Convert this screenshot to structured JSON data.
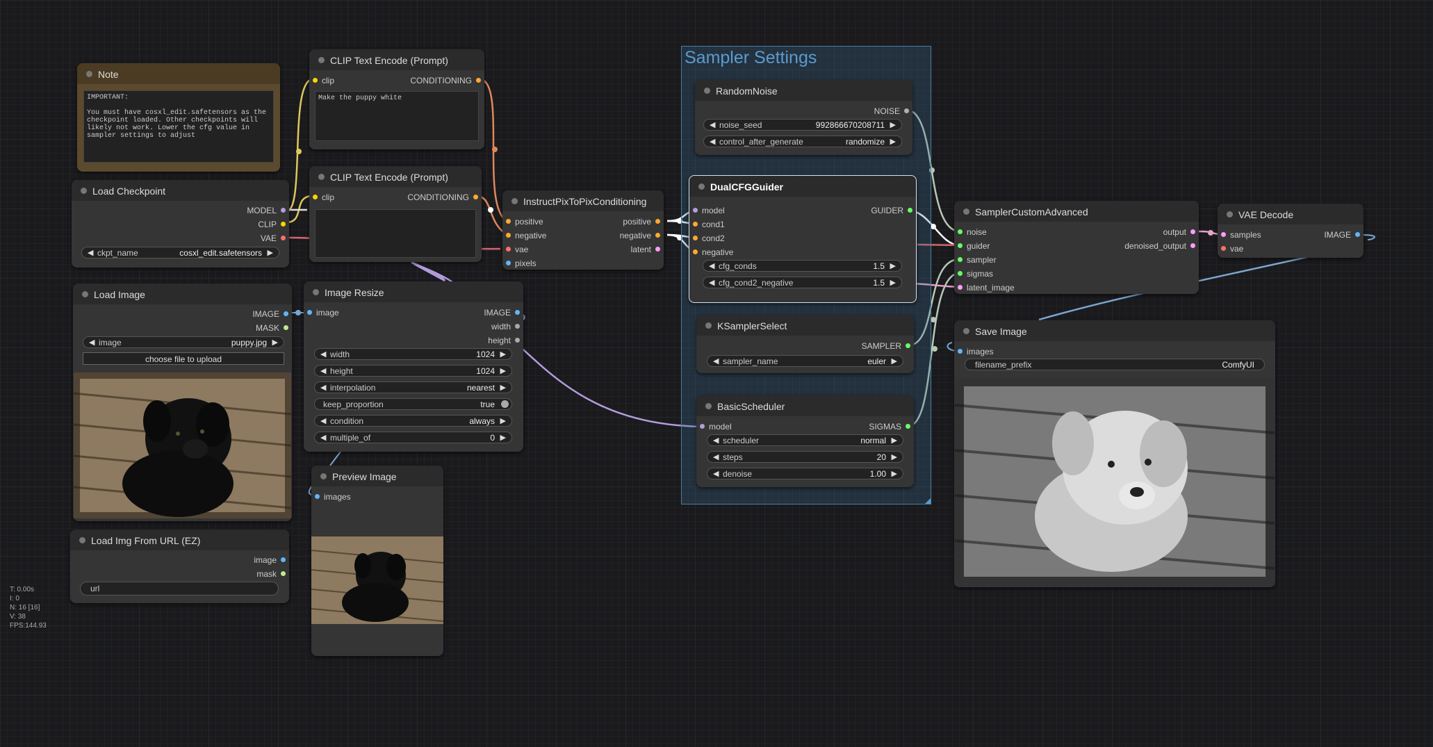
{
  "group": {
    "title": "Sampler Settings"
  },
  "note": {
    "title": "Note",
    "text": "IMPORTANT:\n\nYou must have cosxl_edit.safetensors as the checkpoint loaded. Other checkpoints will likely not work. Lower the cfg value in sampler settings to adjust"
  },
  "clip1": {
    "title": "CLIP Text Encode (Prompt)",
    "in_clip": "clip",
    "out": "CONDITIONING",
    "text": "Make the puppy white"
  },
  "clip2": {
    "title": "CLIP Text Encode (Prompt)",
    "in_clip": "clip",
    "out": "CONDITIONING",
    "text": ""
  },
  "loadckpt": {
    "title": "Load Checkpoint",
    "out_model": "MODEL",
    "out_clip": "CLIP",
    "out_vae": "VAE",
    "ckpt_label": "ckpt_name",
    "ckpt_value": "cosxl_edit.safetensors"
  },
  "ip2p": {
    "title": "InstructPixToPixConditioning",
    "in_positive": "positive",
    "in_negative": "negative",
    "in_vae": "vae",
    "in_pixels": "pixels",
    "out_positive": "positive",
    "out_negative": "negative",
    "out_latent": "latent"
  },
  "randomnoise": {
    "title": "RandomNoise",
    "out": "NOISE",
    "seed_label": "noise_seed",
    "seed_value": "992866670208711",
    "cag_label": "control_after_generate",
    "cag_value": "randomize"
  },
  "dualcfg": {
    "title": "DualCFGGuider",
    "in_model": "model",
    "in_cond1": "cond1",
    "in_cond2": "cond2",
    "in_negative": "negative",
    "out": "GUIDER",
    "cfg_label": "cfg_conds",
    "cfg_value": "1.5",
    "cfg2_label": "cfg_cond2_negative",
    "cfg2_value": "1.5"
  },
  "samplercustom": {
    "title": "SamplerCustomAdvanced",
    "in_noise": "noise",
    "in_guider": "guider",
    "in_sampler": "sampler",
    "in_sigmas": "sigmas",
    "in_latent": "latent_image",
    "out_output": "output",
    "out_denoised": "denoised_output"
  },
  "vaedecode": {
    "title": "VAE Decode",
    "in_samples": "samples",
    "in_vae": "vae",
    "out": "IMAGE"
  },
  "loadimage": {
    "title": "Load Image",
    "out_image": "IMAGE",
    "out_mask": "MASK",
    "image_label": "image",
    "image_value": "puppy.jpg",
    "upload_label": "choose file to upload"
  },
  "imageresize": {
    "title": "Image Resize",
    "in_image": "image",
    "out_image": "IMAGE",
    "out_width": "width",
    "out_height": "height",
    "widgets": [
      {
        "label": "width",
        "value": "1024"
      },
      {
        "label": "height",
        "value": "1024"
      },
      {
        "label": "interpolation",
        "value": "nearest"
      },
      {
        "label": "keep_proportion",
        "value": "true"
      },
      {
        "label": "condition",
        "value": "always"
      },
      {
        "label": "multiple_of",
        "value": "0"
      }
    ]
  },
  "ksamplerselect": {
    "title": "KSamplerSelect",
    "out": "SAMPLER",
    "sampler_label": "sampler_name",
    "sampler_value": "euler"
  },
  "basicscheduler": {
    "title": "BasicScheduler",
    "in_model": "model",
    "out": "SIGMAS",
    "scheduler_label": "scheduler",
    "scheduler_value": "normal",
    "steps_label": "steps",
    "steps_value": "20",
    "denoise_label": "denoise",
    "denoise_value": "1.00"
  },
  "saveimage": {
    "title": "Save Image",
    "in_images": "images",
    "prefix_label": "filename_prefix",
    "prefix_value": "ComfyUI"
  },
  "previewimage": {
    "title": "Preview Image",
    "in_images": "images"
  },
  "loadurl": {
    "title": "Load Img From URL (EZ)",
    "out_image": "image",
    "out_mask": "mask",
    "url_placeholder": "url"
  },
  "stats": {
    "t": "T: 0.00s",
    "i": "I: 0",
    "n": "N: 16 [16]",
    "v": "V: 38",
    "fps": "FPS:144.93"
  },
  "colors": {
    "model": "#b39ddb",
    "clip": "#ffd500",
    "vae": "#ff6e6e",
    "conditioning": "#ffa931",
    "image": "#64b5f6",
    "mask": "#81c784",
    "latent": "#ff9cf9",
    "noise": "#b0b0b0",
    "guider": "#66ffff",
    "sampler": "#ecb4b4",
    "sigmas": "#cdffcd"
  }
}
